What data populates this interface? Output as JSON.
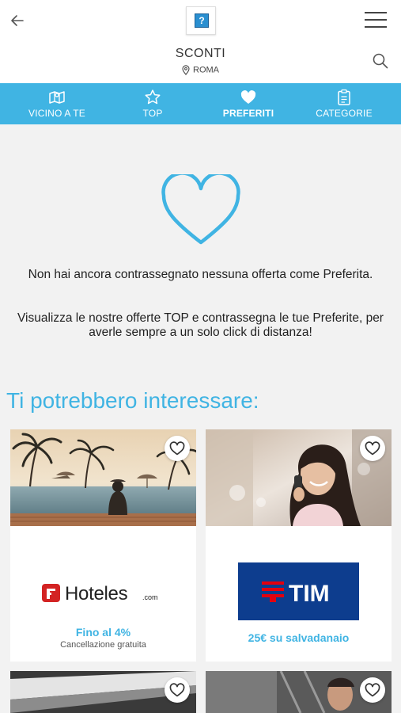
{
  "header": {
    "title": "SCONTI",
    "location": "ROMA",
    "logo_mark": "?"
  },
  "tabs": [
    {
      "label": "VICINO A TE",
      "icon": "map-icon",
      "active": false
    },
    {
      "label": "TOP",
      "icon": "star-icon",
      "active": false
    },
    {
      "label": "PREFERITI",
      "icon": "heart-icon",
      "active": true
    },
    {
      "label": "CATEGORIE",
      "icon": "clipboard-icon",
      "active": false
    }
  ],
  "empty_state": {
    "line1": "Non hai ancora contrassegnato nessuna offerta come Preferita.",
    "line2": "Visualizza le nostre offerte TOP e contrassegna le tue Preferite, per averle sempre a un solo click di distanza!"
  },
  "suggestions": {
    "title": "Ti potrebbero interessare:",
    "cards": [
      {
        "brand": "Hoteles",
        "brand_suffix": ".com",
        "offer": "Fino al 4%",
        "sub": "Cancellazione gratuita"
      },
      {
        "brand": "TIM",
        "offer": "25€ su salvadanaio",
        "sub": ""
      }
    ]
  },
  "colors": {
    "accent": "#40b4e3",
    "tim_blue": "#0d3d8e",
    "tim_red": "#e3000f",
    "hoteles_red": "#d32323"
  }
}
